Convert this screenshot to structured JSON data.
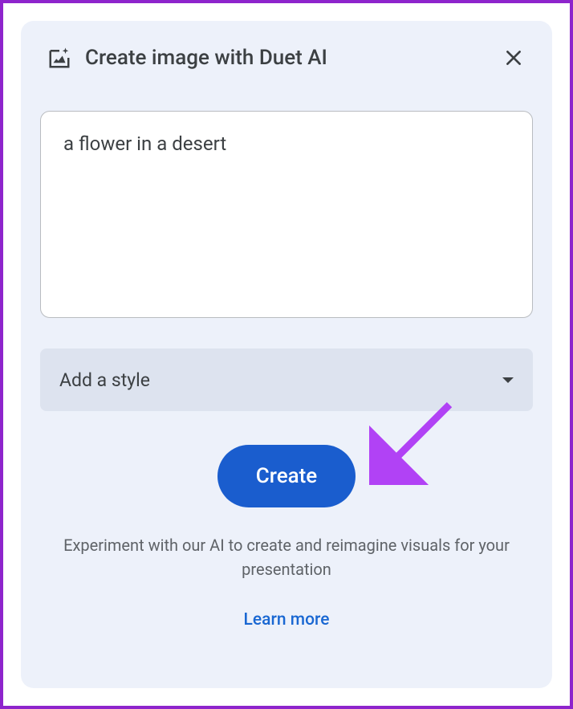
{
  "header": {
    "title": "Create image with Duet AI"
  },
  "prompt": {
    "value": "a flower in a desert"
  },
  "styleDropdown": {
    "label": "Add a style"
  },
  "createButton": {
    "label": "Create"
  },
  "description": {
    "text": "Experiment with our AI to create and reimagine visuals for your presentation"
  },
  "learnMore": {
    "label": "Learn more"
  },
  "colors": {
    "accent": "#1a5dce",
    "link": "#1967d2",
    "annotationArrow": "#b142f5",
    "border": "#8e24cc"
  }
}
